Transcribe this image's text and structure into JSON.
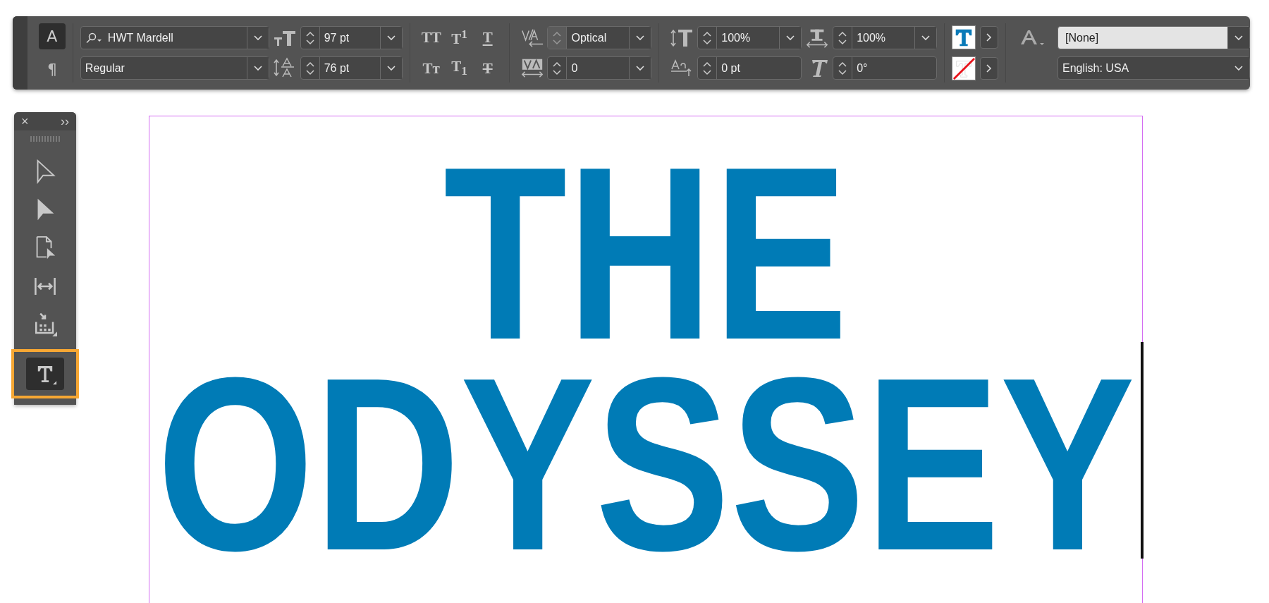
{
  "control_panel": {
    "mode_buttons": [
      {
        "label": "A",
        "selected": true
      },
      {
        "label": "¶",
        "selected": false
      }
    ],
    "font_family": "HWT Mardell",
    "font_style": "Regular",
    "font_size": "97 pt",
    "leading": "76 pt",
    "type_buttons": [
      {
        "label": "TT",
        "kind": "plain"
      },
      {
        "label": "T$^{1}$",
        "kind": "plain"
      },
      {
        "label": "T",
        "kind": "underline"
      },
      {
        "label": "Tᴛ",
        "kind": "plain"
      },
      {
        "label": "T$_{1}$",
        "kind": "plain"
      },
      {
        "label": "T",
        "kind": "strikethrough"
      }
    ],
    "kerning": "Optical",
    "tracking": "0",
    "vertical_scale": "100%",
    "baseline_shift": "0 pt",
    "horizontal_scale": "100%",
    "skew": "0°",
    "character_style": "[None]",
    "language": "English: USA"
  },
  "tools_panel": {
    "close": "×",
    "expand": "››",
    "tools": [
      {
        "kind": "selection",
        "selected": false
      },
      {
        "kind": "direct-selection",
        "selected": false
      },
      {
        "kind": "page",
        "selected": false
      },
      {
        "kind": "gap",
        "selected": false
      },
      {
        "kind": "content-collector",
        "selected": false
      },
      {
        "kind": "type",
        "selected": true
      }
    ]
  },
  "page": {
    "lines": [
      "THE",
      "ODYSSEY"
    ]
  }
}
